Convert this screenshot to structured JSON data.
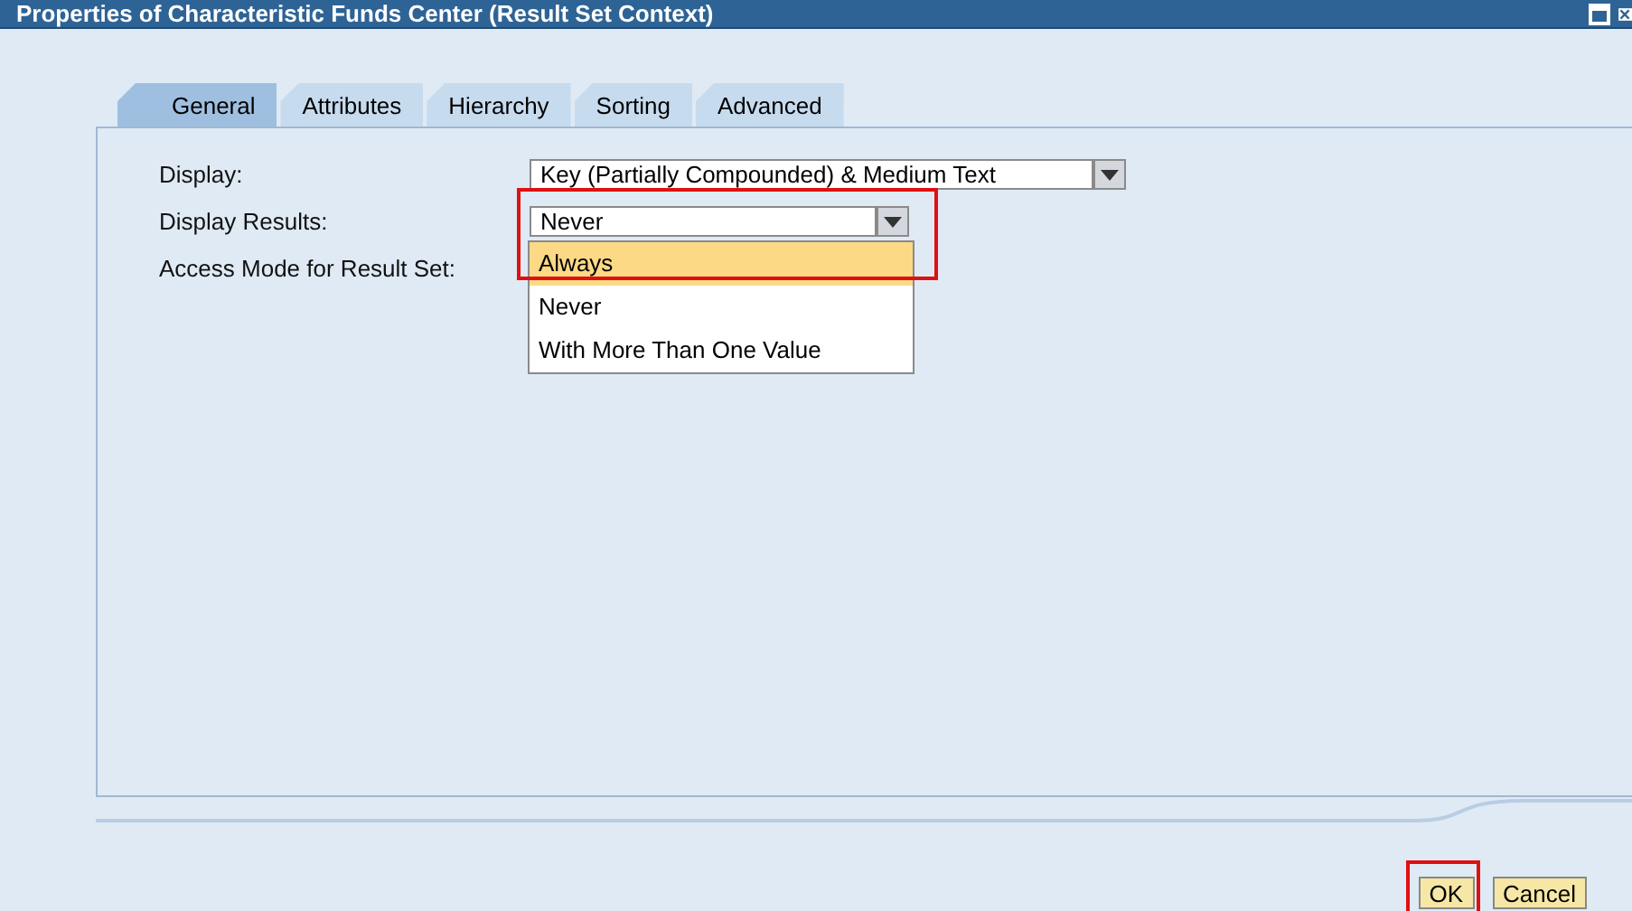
{
  "window": {
    "title": "Properties of Characteristic Funds Center (Result Set Context)"
  },
  "tabs": [
    {
      "label": "General",
      "selected": true
    },
    {
      "label": "Attributes",
      "selected": false
    },
    {
      "label": "Hierarchy",
      "selected": false
    },
    {
      "label": "Sorting",
      "selected": false
    },
    {
      "label": "Advanced",
      "selected": false
    }
  ],
  "fields": [
    {
      "label": "Display:",
      "value": "Key (Partially Compounded) & Medium Text"
    },
    {
      "label": "Display Results:",
      "value": "Never",
      "highlighted": true,
      "options": [
        {
          "label": "Always",
          "highlighted": true
        },
        {
          "label": "Never",
          "highlighted": false
        },
        {
          "label": "With More Than One Value",
          "highlighted": false
        }
      ]
    },
    {
      "label": "Access Mode for Result Set:"
    }
  ],
  "buttons": [
    {
      "label": "OK",
      "highlighted": true
    },
    {
      "label": "Cancel"
    }
  ]
}
